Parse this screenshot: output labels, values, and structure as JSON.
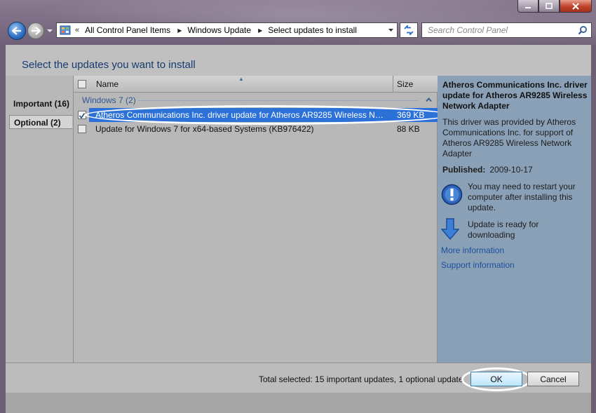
{
  "address": {
    "chevron": "«",
    "crumbs": [
      "All Control Panel Items",
      "Windows Update",
      "Select updates to install"
    ]
  },
  "search": {
    "placeholder": "Search Control Panel"
  },
  "page": {
    "title": "Select the updates you want to install"
  },
  "categories": [
    {
      "label": "Important (16)"
    },
    {
      "label": "Optional (2)",
      "selected": true
    }
  ],
  "list": {
    "columns": {
      "name": "Name",
      "size": "Size"
    },
    "group": "Windows 7 (2)",
    "rows": [
      {
        "name": "Atheros Communications Inc. driver update for Atheros AR9285 Wireless Net...",
        "size": "369 KB",
        "checked": true,
        "selected": true
      },
      {
        "name": "Update for Windows 7 for x64-based Systems (KB976422)",
        "size": "88 KB",
        "checked": false,
        "selected": false
      }
    ]
  },
  "details": {
    "title": "Atheros Communications Inc. driver update for Atheros AR9285 Wireless Network Adapter",
    "description": "This driver was provided by Atheros Communications Inc. for support of Atheros AR9285 Wireless Network Adapter",
    "published_label": "Published:",
    "published_value": "2009-10-17",
    "restart_note": "You may need to restart your computer after installing this update.",
    "download_note": "Update is ready for downloading",
    "more_info": "More information",
    "support_info": "Support information"
  },
  "footer": {
    "total": "Total selected: 15 important updates, 1 optional update",
    "ok": "OK",
    "cancel": "Cancel"
  },
  "icons": {
    "back": "back-arrow-icon",
    "forward": "forward-arrow-icon",
    "search": "search-icon",
    "refresh": "refresh-icon",
    "restart": "restart-info-icon",
    "download": "download-arrow-icon"
  },
  "colors": {
    "selection": "#2b71d7",
    "link": "#1c4f9c",
    "title": "#163b70"
  }
}
